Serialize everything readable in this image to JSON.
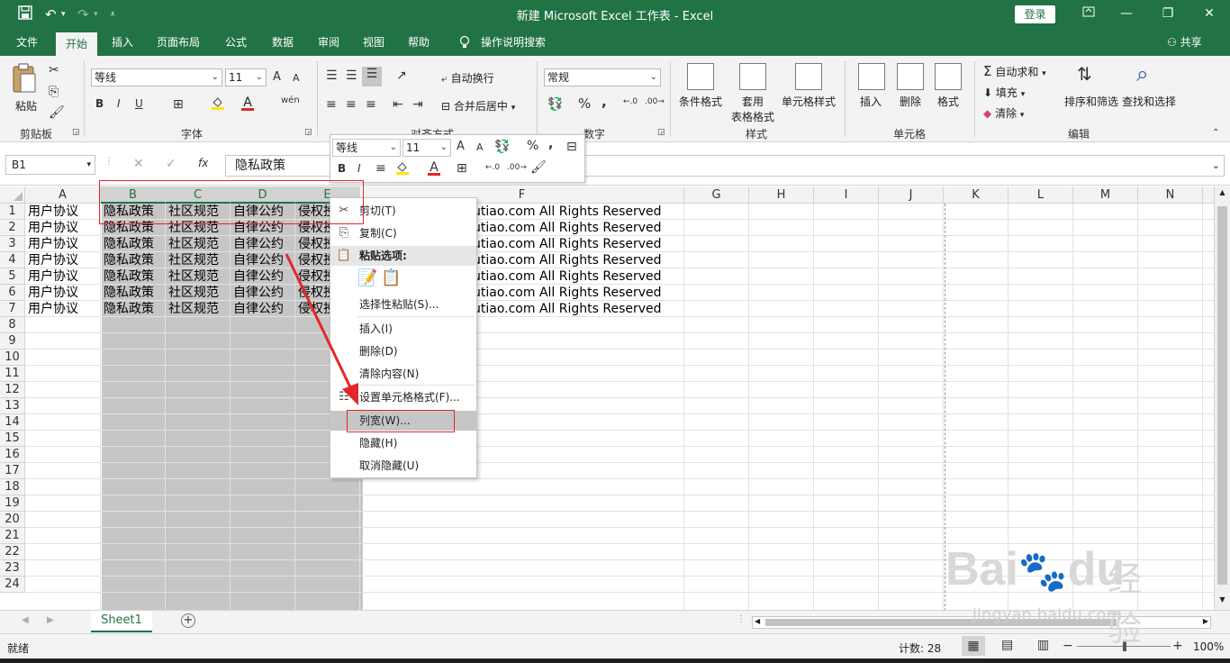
{
  "titlebar": {
    "title": "新建 Microsoft Excel 工作表 - Excel",
    "login": "登录",
    "save_icon": "save-icon",
    "undo_icon": "undo-icon",
    "redo_icon": "redo-icon"
  },
  "tabs": [
    {
      "label": "文件"
    },
    {
      "label": "开始"
    },
    {
      "label": "插入"
    },
    {
      "label": "页面布局"
    },
    {
      "label": "公式"
    },
    {
      "label": "数据"
    },
    {
      "label": "审阅"
    },
    {
      "label": "视图"
    },
    {
      "label": "帮助"
    },
    {
      "label": "操作说明搜索"
    }
  ],
  "share": "共享",
  "ribbon": {
    "clipboard": {
      "paste": "粘贴",
      "label": "剪贴板"
    },
    "font": {
      "name": "等线",
      "size": "11",
      "label": "字体",
      "bold": "B",
      "italic": "I",
      "underline": "U",
      "grow": "A",
      "shrink": "A",
      "text_color": "A",
      "phonetic": "wén"
    },
    "alignment": {
      "wrap": "自动换行",
      "merge": "合并后居中",
      "label": "对齐方式"
    },
    "number": {
      "format": "常规",
      "label": "数字",
      "percent": "%",
      "comma": ","
    },
    "styles": {
      "conditional": "条件格式",
      "table": "套用",
      "table2": "表格格式",
      "cell_styles": "单元格样式",
      "label": "样式"
    },
    "cells": {
      "insert": "插入",
      "delete": "删除",
      "format": "格式",
      "label": "单元格"
    },
    "editing": {
      "autosum": "自动求和",
      "fill": "填充",
      "clear": "清除",
      "sort": "排序和筛选",
      "find": "查找和选择",
      "label": "编辑"
    }
  },
  "formula_bar": {
    "name_box": "B1",
    "fx": "fx",
    "content": "隐私政策"
  },
  "columns": [
    "A",
    "B",
    "C",
    "D",
    "E",
    "F",
    "G",
    "H",
    "I",
    "J",
    "K",
    "L",
    "M",
    "N"
  ],
  "rows": [
    "1",
    "2",
    "3",
    "4",
    "5",
    "6",
    "7",
    "8",
    "9",
    "10",
    "11",
    "12",
    "13",
    "14",
    "15",
    "16",
    "17",
    "18",
    "19",
    "20",
    "21",
    "22",
    "23",
    "24"
  ],
  "cells": {
    "a": "用户协议",
    "b": "隐私政策",
    "c": "社区规范",
    "d": "自律公约",
    "e": "侵权投",
    "f": "utiao.com All Rights Reserved"
  },
  "mini_toolbar": {
    "font": "等线",
    "size": "11",
    "bold": "B",
    "italic": "I",
    "percent": "%",
    "comma": ","
  },
  "context_menu": {
    "cut": "剪切(T)",
    "copy": "复制(C)",
    "paste_options": "粘贴选项:",
    "paste_special": "选择性粘贴(S)...",
    "insert": "插入(I)",
    "delete": "删除(D)",
    "clear": "清除内容(N)",
    "format_cells": "设置单元格格式(F)...",
    "col_width": "列宽(W)...",
    "hide": "隐藏(H)",
    "unhide": "取消隐藏(U)"
  },
  "sheet": {
    "tab": "Sheet1",
    "add": "+"
  },
  "status": {
    "ready": "就绪",
    "count": "计数: 28",
    "zoom": "100%",
    "minus": "−",
    "plus": "+"
  },
  "watermark": {
    "brand": "Bai",
    "brand2": "du",
    "cn": "经验",
    "url": "jingyan.baidu.com"
  },
  "colors": {
    "accent": "#217346",
    "annotation": "#e0282a",
    "selection": "#c6c6c6"
  }
}
